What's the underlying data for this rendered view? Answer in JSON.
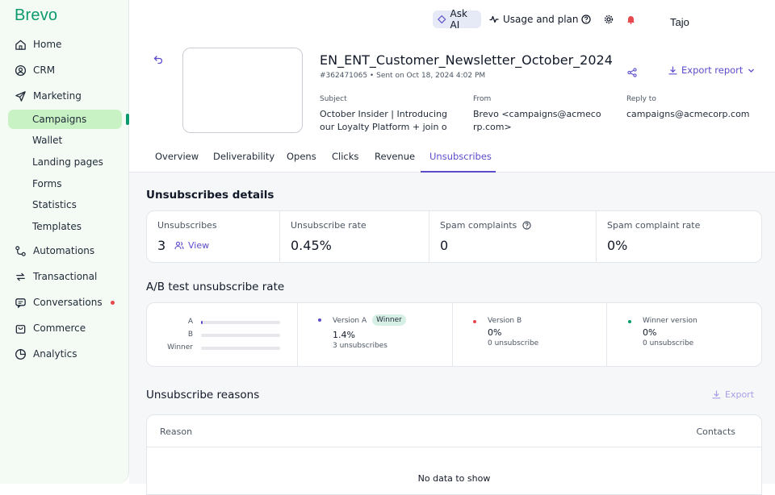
{
  "brand": {
    "logo": "Brevo",
    "accent": "#0b996e",
    "link_color": "#5b4ccc"
  },
  "sidebar": {
    "items": [
      {
        "label": "Home",
        "icon": "home-icon"
      },
      {
        "label": "CRM",
        "icon": "contacts-icon"
      },
      {
        "label": "Marketing",
        "icon": "send-icon"
      },
      {
        "label": "Automations",
        "icon": "automation-icon"
      },
      {
        "label": "Transactional",
        "icon": "arrows-icon"
      },
      {
        "label": "Conversations",
        "icon": "chat-icon"
      },
      {
        "label": "Commerce",
        "icon": "bag-icon"
      },
      {
        "label": "Analytics",
        "icon": "pie-icon"
      }
    ],
    "sub_items": [
      {
        "label": "Campaigns",
        "active": true
      },
      {
        "label": "Wallet"
      },
      {
        "label": "Landing pages"
      },
      {
        "label": "Forms"
      },
      {
        "label": "Statistics"
      },
      {
        "label": "Templates"
      }
    ]
  },
  "topbar": {
    "ask_ai": "Ask AI",
    "usage": "Usage and plan",
    "account": "Tajo"
  },
  "campaign": {
    "title": "EN_ENT_Customer_Newsletter_October_2024",
    "id_sent": "#362471065 • Sent on Oct 18, 2024 4:02 PM",
    "subject_label": "Subject",
    "subject_value": "October Insider | Introducing our Loyalty Platform + join ou...",
    "from_label": "From",
    "from_value": "Brevo <campaigns@acmecorp.com>",
    "reply_label": "Reply to",
    "reply_value": "campaigns@acmecorp.com",
    "export_report": "Export report"
  },
  "tabs": [
    "Overview",
    "Deliverability",
    "Opens",
    "Clicks",
    "Revenue",
    "Unsubscribes"
  ],
  "active_tab": "Unsubscribes",
  "unsub_details": {
    "title": "Unsubscribes details",
    "stats": [
      {
        "label": "Unsubscribes",
        "value": "3",
        "link": "View"
      },
      {
        "label": "Unsubscribe rate",
        "value": "0.45%"
      },
      {
        "label": "Spam complaints",
        "value": "0"
      },
      {
        "label": "Spam complaint rate",
        "value": "0%"
      }
    ]
  },
  "ab_test": {
    "title": "A/B test unsubscribe rate",
    "bars": [
      {
        "label": "A",
        "fraction": 0.02
      },
      {
        "label": "B",
        "fraction": 0
      },
      {
        "label": "Winner",
        "fraction": 0
      }
    ],
    "versions": [
      {
        "name": "Version A",
        "badge": "Winner",
        "value": "1.4%",
        "sub": "3 unsubscribes",
        "color": "#5b4ccc"
      },
      {
        "name": "Version B",
        "value": "0%",
        "sub": "0 unsubscribe",
        "color": "#e5484d"
      },
      {
        "name": "Winner version",
        "value": "0%",
        "sub": "0 unsubscribe",
        "color": "#0b996e"
      }
    ]
  },
  "reasons": {
    "title": "Unsubscribe reasons",
    "export": "Export",
    "col_reason": "Reason",
    "col_contacts": "Contacts",
    "empty": "No data to show"
  }
}
